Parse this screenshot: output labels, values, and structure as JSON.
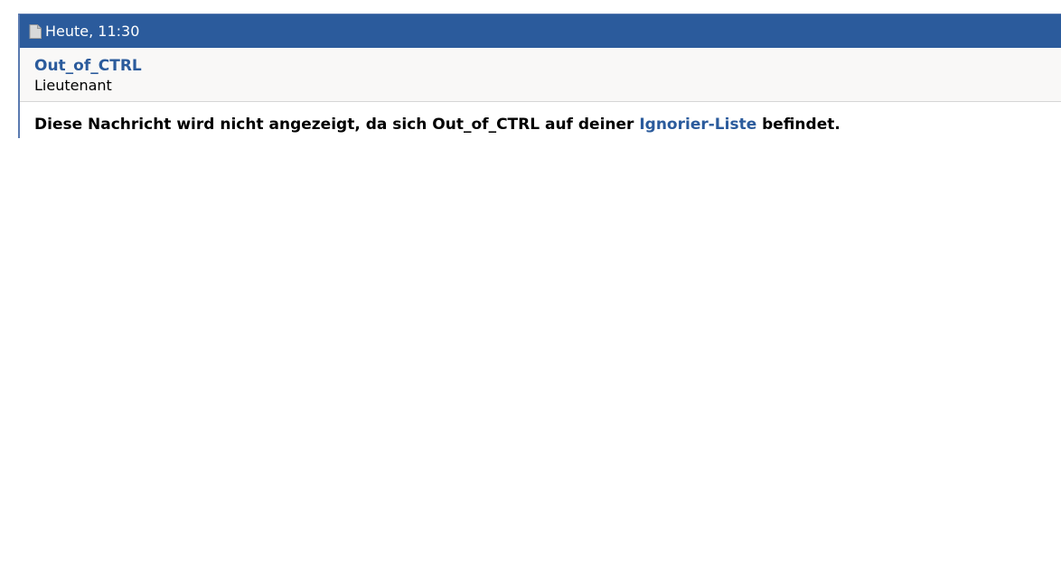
{
  "post": {
    "timestamp": "Heute, 11:30",
    "icon": "document-icon",
    "author": {
      "name": "Out_of_CTRL",
      "rank": "Lieutenant"
    },
    "ignored_notice": {
      "before_link": "Diese Nachricht wird nicht angezeigt, da sich Out_of_CTRL auf deiner ",
      "link_label": "Ignorier-Liste",
      "after_link": " befindet."
    }
  },
  "colors": {
    "header_bg": "#2b5b9c",
    "link": "#2b5b9c",
    "user_bar_bg": "#f9f8f7"
  }
}
